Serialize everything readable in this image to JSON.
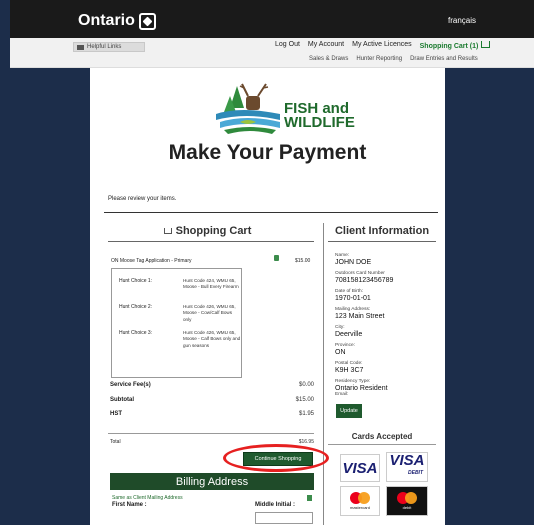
{
  "header": {
    "brand": "Ontario",
    "language_link": "français"
  },
  "utility": {
    "helpful_links": "Helpful Links",
    "nav": [
      "Log Out",
      "My Account",
      "My Active Licences"
    ],
    "cart_link": "Shopping Cart (1)",
    "nav2": [
      "Sales & Draws",
      "Hunter Reporting",
      "Draw Entries and Results"
    ]
  },
  "branding": {
    "line1": "FISH and",
    "line2": "WILDLIFE"
  },
  "page": {
    "title": "Make Your Payment",
    "review_text": "Please review your items."
  },
  "cart": {
    "title": "Shopping Cart",
    "item_name": "ON Moose Tag Application - Primary",
    "item_price": "$15.00",
    "hunt_choices": [
      {
        "label": "Hunt Choice 1:",
        "value": "Hunt Code 424, WMU 65, Moose - Bull Every Firearm"
      },
      {
        "label": "Hunt Choice 2:",
        "value": "Hunt Code 426, WMU 65, Moose - Cow/Calf Bows only"
      },
      {
        "label": "Hunt Choice 3:",
        "value": "Hunt Code 426, WMU 65, Moose - Calf Bows only and gun seasons"
      }
    ],
    "service_fee_label": "Service Fee(s)",
    "service_fee_value": "$0.00",
    "subtotal_label": "Subtotal",
    "subtotal_value": "$15.00",
    "hst_label": "HST",
    "hst_value": "$1.95",
    "total_label": "Total",
    "total_value": "$16.95",
    "continue_label": "Continue Shopping"
  },
  "billing": {
    "title": "Billing Address",
    "same_as": "Same as Client Mailing Address",
    "first_name_label": "First Name :",
    "middle_initial_label": "Middle Initial :"
  },
  "client": {
    "title": "Client Information",
    "fields": [
      {
        "label": "Name:",
        "value": "JOHN DOE"
      },
      {
        "label": "Outdoors Card Number",
        "value": "708158123456789"
      },
      {
        "label": "Date of Birth:",
        "value": "1970-01-01"
      },
      {
        "label": "Mailing Address:",
        "value": "123 Main Street"
      },
      {
        "label": "City:",
        "value": "Deerville"
      },
      {
        "label": "Province:",
        "value": "ON"
      },
      {
        "label": "Postal Code:",
        "value": "K9H 3C7"
      },
      {
        "label": "Residency Type:",
        "value": "Ontario Resident"
      },
      {
        "label": "Email:",
        "value": ""
      }
    ],
    "update_label": "Update"
  },
  "cards": {
    "title": "Cards Accepted",
    "visa": "VISA",
    "visa_debit": "VISA",
    "visa_debit_sub": "DEBIT",
    "mastercard": "mastercard",
    "mastercard_debit": "debit"
  },
  "colors": {
    "page_bg": "#1c2d4a",
    "brand_green": "#1f5a2e",
    "highlight_red": "#e62020"
  }
}
